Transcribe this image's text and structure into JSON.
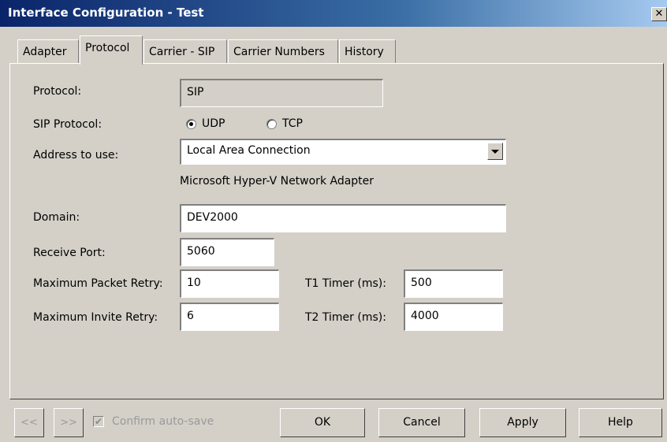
{
  "window": {
    "title": "Interface Configuration - Test",
    "close_glyph": "✕"
  },
  "tabs": [
    {
      "label": "Adapter",
      "active": false
    },
    {
      "label": "Protocol",
      "active": true
    },
    {
      "label": "Carrier - SIP",
      "active": false
    },
    {
      "label": "Carrier Numbers",
      "active": false
    },
    {
      "label": "History",
      "active": false
    }
  ],
  "form": {
    "protocol_label": "Protocol:",
    "protocol_value": "SIP",
    "sip_protocol_label": "SIP Protocol:",
    "sip_protocol_options": [
      {
        "label": "UDP",
        "selected": true
      },
      {
        "label": "TCP",
        "selected": false
      }
    ],
    "address_label": "Address to use:",
    "address_value": "Local Area Connection",
    "adapter_description": "Microsoft Hyper-V Network Adapter",
    "domain_label": "Domain:",
    "domain_value": "DEV2000",
    "receive_port_label": "Receive Port:",
    "receive_port_value": "5060",
    "max_packet_retry_label": "Maximum Packet Retry:",
    "max_packet_retry_value": "10",
    "max_invite_retry_label": "Maximum Invite Retry:",
    "max_invite_retry_value": "6",
    "t1_label": "T1 Timer (ms):",
    "t1_value": "500",
    "t2_label": "T2 Timer (ms):",
    "t2_value": "4000"
  },
  "footer": {
    "prev_label": "<<",
    "next_label": ">>",
    "confirm_autosave_label": "Confirm auto-save",
    "confirm_autosave_checked": true,
    "check_glyph": "✔",
    "ok_label": "OK",
    "cancel_label": "Cancel",
    "apply_label": "Apply",
    "help_label": "Help"
  }
}
